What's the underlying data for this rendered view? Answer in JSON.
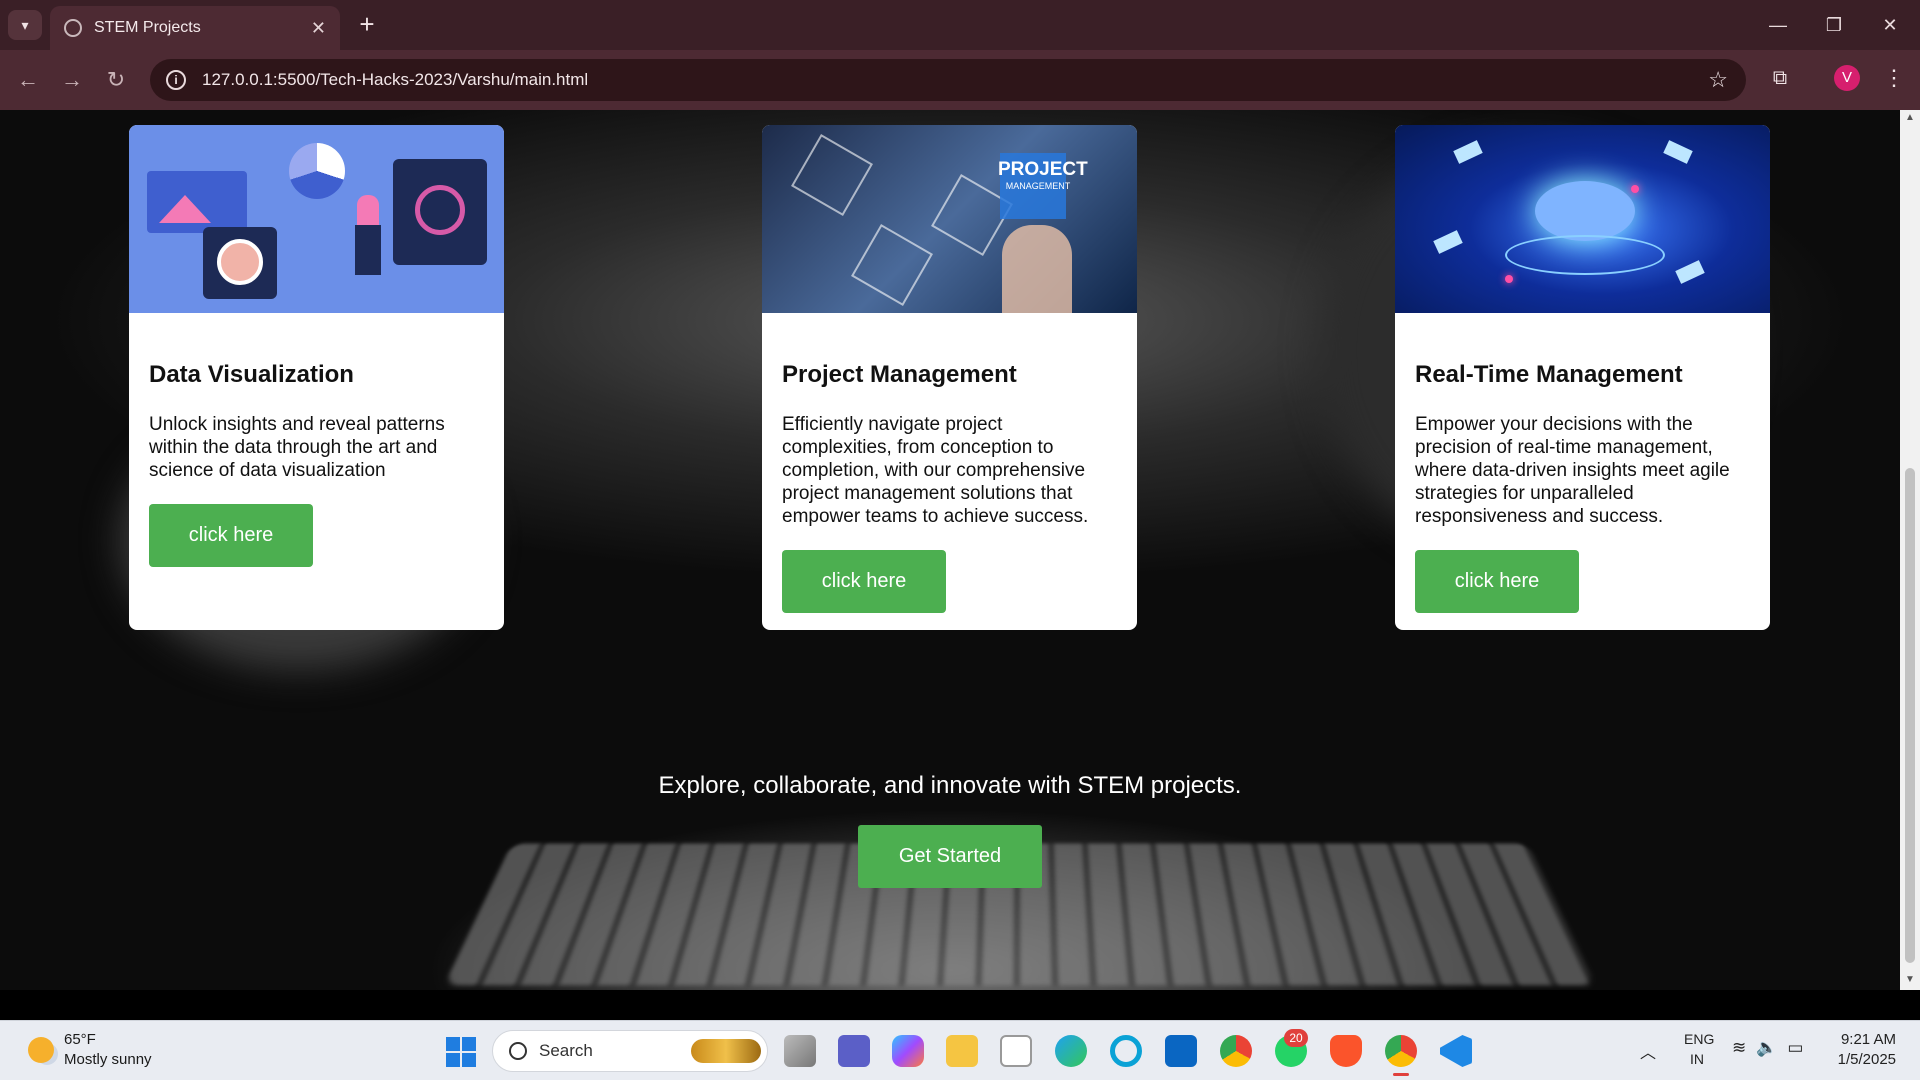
{
  "browser": {
    "tab_title": "STEM Projects",
    "url": "127.0.0.1:5500/Tech-Hacks-2023/Varshu/main.html",
    "profile_initial": "V"
  },
  "cards": [
    {
      "title": "Data Visualization",
      "description": "Unlock insights and reveal patterns within the data through the art and science of data visualization",
      "button": "click here"
    },
    {
      "title": "Project Management",
      "description": "Efficiently navigate project complexities, from conception to completion, with our comprehensive project management solutions that empower teams to achieve success.",
      "button": "click here",
      "image_text": "PROJECT",
      "image_subtext": "MANAGEMENT"
    },
    {
      "title": "Real-Time Management",
      "description": "Empower your decisions with the precision of real-time management, where data-driven insights meet agile strategies for unparalleled responsiveness and success.",
      "button": "click here"
    }
  ],
  "hero": {
    "tagline": "Explore, collaborate, and innovate with STEM projects.",
    "cta": "Get Started"
  },
  "taskbar": {
    "weather_temp": "65°F",
    "weather_desc": "Mostly sunny",
    "search_label": "Search",
    "whatsapp_badge": "20",
    "lang_line1": "ENG",
    "lang_line2": "IN",
    "time": "9:21 AM",
    "date": "1/5/2025"
  },
  "colors": {
    "accent_green": "#4caf50",
    "browser_frame": "#4d2a33"
  }
}
